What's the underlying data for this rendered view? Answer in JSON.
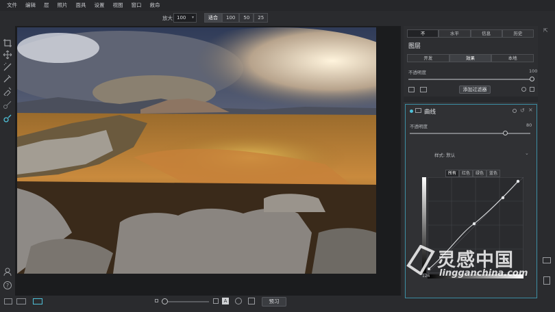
{
  "menu": [
    "文件",
    "编辑",
    "层",
    "照片",
    "面具",
    "设置",
    "视图",
    "窗口",
    "救命"
  ],
  "toolbar": {
    "zoom_label": "放大",
    "zoom_value": "100",
    "zoom_buttons": [
      "适合",
      "100",
      "50",
      "25"
    ]
  },
  "right_panel": {
    "top_tabs": [
      "不",
      "水平",
      "信息",
      "历史"
    ],
    "layers_title": "图层",
    "mid_tabs": [
      "开发",
      "效果",
      "本地"
    ],
    "opacity_label": "不透明度",
    "opacity_value": "100",
    "add_filter_label": "添加过滤器",
    "curves": {
      "title": "曲线",
      "opacity_label": "不透明度",
      "opacity_value": "80",
      "style_label": "样式: 默认",
      "channels": [
        "所有",
        "红色",
        "绿色",
        "蓝色"
      ],
      "input_value": "126"
    }
  },
  "bottom": {
    "preview_label": "预习"
  },
  "watermark": {
    "text_cn": "灵感中国",
    "url": "lingganchina.com"
  },
  "colors": {
    "accent_cyan": "#4fc1d9",
    "panel_bg": "#2d2e31",
    "app_bg": "#2a2b2e"
  }
}
